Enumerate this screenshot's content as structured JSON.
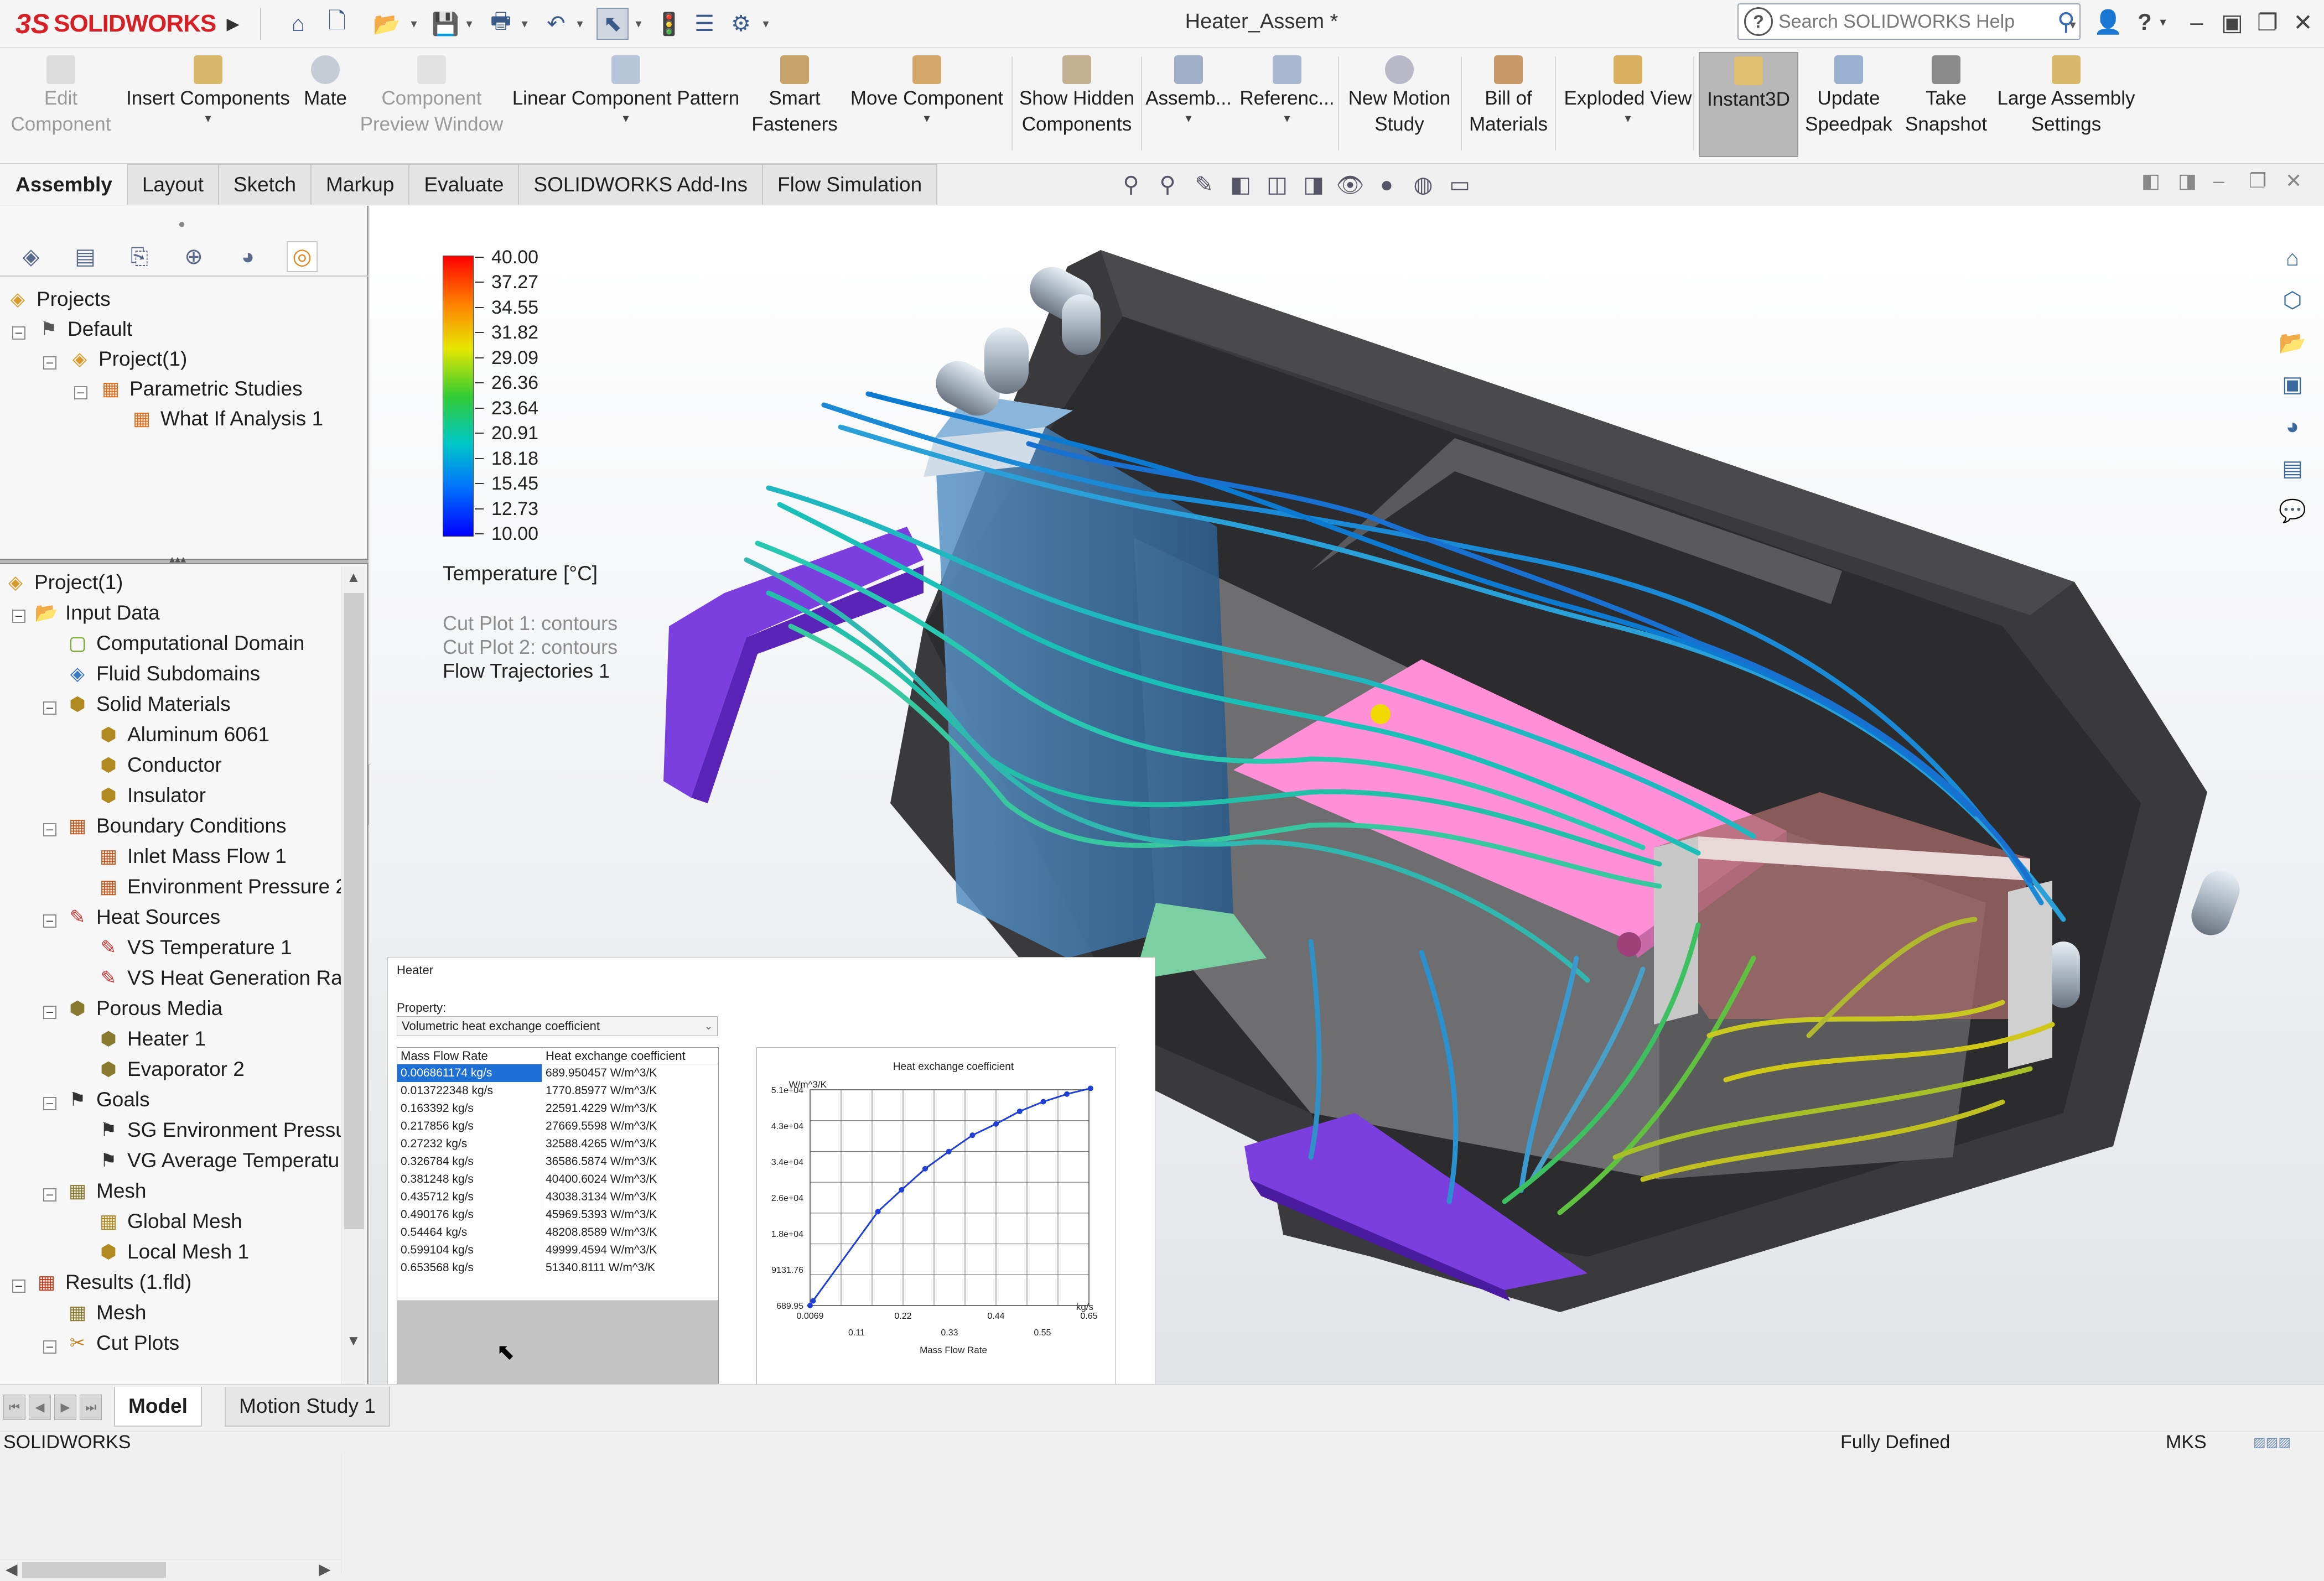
{
  "app": {
    "brand": "SOLIDWORKS",
    "document_title": "Heater_Assem *",
    "search_placeholder": "Search SOLIDWORKS Help"
  },
  "commands": [
    {
      "label": "Edit\nComponent",
      "enabled": false
    },
    {
      "label": "Insert Components",
      "enabled": true
    },
    {
      "label": "Mate",
      "enabled": true
    },
    {
      "label": "Component\nPreview Window",
      "enabled": false
    },
    {
      "label": "Linear Component Pattern",
      "enabled": true
    },
    {
      "label": "Smart\nFasteners",
      "enabled": true
    },
    {
      "label": "Move Component",
      "enabled": true
    },
    {
      "label": "Show Hidden\nComponents",
      "enabled": true
    },
    {
      "label": "Assemb...",
      "enabled": true
    },
    {
      "label": "Referenc...",
      "enabled": true
    },
    {
      "label": "New Motion\nStudy",
      "enabled": true
    },
    {
      "label": "Bill of\nMaterials",
      "enabled": true
    },
    {
      "label": "Exploded View",
      "enabled": true
    },
    {
      "label": "Instant3D",
      "enabled": true
    },
    {
      "label": "Update\nSpeedpak",
      "enabled": true
    },
    {
      "label": "Take\nSnapshot",
      "enabled": true
    },
    {
      "label": "Large Assembly\nSettings",
      "enabled": true
    }
  ],
  "tabs": [
    "Assembly",
    "Layout",
    "Sketch",
    "Markup",
    "Evaluate",
    "SOLIDWORKS Add-Ins",
    "Flow Simulation"
  ],
  "active_tab": "Assembly",
  "project_tree": [
    {
      "label": "Projects",
      "icon": "projects-icon"
    },
    {
      "label": "Default",
      "icon": "config-icon"
    },
    {
      "label": "Project(1)",
      "icon": "project-icon"
    },
    {
      "label": "Parametric Studies",
      "icon": "parametric-icon"
    },
    {
      "label": "What If Analysis 1",
      "icon": "analysis-icon"
    }
  ],
  "analysis_tree": [
    {
      "label": "Project(1)"
    },
    {
      "label": "Input Data"
    },
    {
      "label": "Computational Domain"
    },
    {
      "label": "Fluid Subdomains"
    },
    {
      "label": "Solid Materials"
    },
    {
      "label": "Aluminum 6061"
    },
    {
      "label": "Conductor"
    },
    {
      "label": "Insulator"
    },
    {
      "label": "Boundary Conditions"
    },
    {
      "label": "Inlet Mass Flow 1"
    },
    {
      "label": "Environment Pressure 2"
    },
    {
      "label": "Heat Sources"
    },
    {
      "label": "VS Temperature 1"
    },
    {
      "label": "VS Heat Generation Ra"
    },
    {
      "label": "Porous Media"
    },
    {
      "label": "Heater 1"
    },
    {
      "label": "Evaporator 2"
    },
    {
      "label": "Goals"
    },
    {
      "label": "SG Environment Pressu"
    },
    {
      "label": "VG Average Temperatu"
    },
    {
      "label": "Mesh"
    },
    {
      "label": "Global Mesh"
    },
    {
      "label": "Local Mesh 1"
    },
    {
      "label": "Results (1.fld)"
    },
    {
      "label": "Mesh"
    },
    {
      "label": "Cut Plots"
    }
  ],
  "legend": {
    "values": [
      "40.00",
      "37.27",
      "34.55",
      "31.82",
      "29.09",
      "26.36",
      "23.64",
      "20.91",
      "18.18",
      "15.45",
      "12.73",
      "10.00"
    ],
    "title": "Temperature [°C]",
    "items": [
      "Cut Plot 1: contours",
      "Cut Plot 2: contours",
      "Flow Trajectories 1"
    ]
  },
  "heater_dialog": {
    "title": "Heater",
    "property_label": "Property:",
    "property_value": "Volumetric heat exchange coefficient",
    "columns": [
      "Mass Flow Rate",
      "Heat exchange coefficient"
    ],
    "rows": [
      [
        "0.006861174 kg/s",
        "689.950457 W/m^3/K"
      ],
      [
        "0.013722348 kg/s",
        "1770.85977 W/m^3/K"
      ],
      [
        "0.163392 kg/s",
        "22591.4229 W/m^3/K"
      ],
      [
        "0.217856 kg/s",
        "27669.5598 W/m^3/K"
      ],
      [
        "0.27232 kg/s",
        "32588.4265 W/m^3/K"
      ],
      [
        "0.326784 kg/s",
        "36586.5874 W/m^3/K"
      ],
      [
        "0.381248 kg/s",
        "40400.6024 W/m^3/K"
      ],
      [
        "0.435712 kg/s",
        "43038.3134 W/m^3/K"
      ],
      [
        "0.490176 kg/s",
        "45969.5393 W/m^3/K"
      ],
      [
        "0.54464 kg/s",
        "48208.8589 W/m^3/K"
      ],
      [
        "0.599104 kg/s",
        "49999.4594 W/m^3/K"
      ],
      [
        "0.653568 kg/s",
        "51340.8111 W/m^3/K"
      ]
    ],
    "selected_row": 0
  },
  "chart_data": {
    "type": "line",
    "title": "Heat exchange coefficient",
    "xlabel": "Mass Flow Rate",
    "ylabel": "W/m^3/K",
    "x_unit": "kg/s",
    "x_ticks_top": [
      "0.0069",
      "0.22",
      "0.44",
      "0.65"
    ],
    "x_ticks_bottom": [
      "0.11",
      "0.33",
      "0.55"
    ],
    "y_ticks": [
      "5.1e+04",
      "4.3e+04",
      "3.4e+04",
      "2.6e+04",
      "1.8e+04",
      "9131.76",
      "689.95"
    ],
    "xlim": [
      0.0069,
      0.65
    ],
    "ylim": [
      689.95,
      51000
    ],
    "x": [
      0.006861,
      0.013722,
      0.163392,
      0.217856,
      0.27232,
      0.326784,
      0.381248,
      0.435712,
      0.490176,
      0.54464,
      0.599104,
      0.653568
    ],
    "values": [
      689.95,
      1770.86,
      22591.42,
      27669.56,
      32588.43,
      36586.59,
      40400.6,
      43038.31,
      45969.54,
      48208.86,
      49999.46,
      51340.81
    ],
    "grid": true,
    "color": "#1f3fd6"
  },
  "bottom_tabs": [
    "Model",
    "Motion Study 1"
  ],
  "status": {
    "left": "SOLIDWORKS",
    "middle": "Fully Defined",
    "units": "MKS"
  }
}
